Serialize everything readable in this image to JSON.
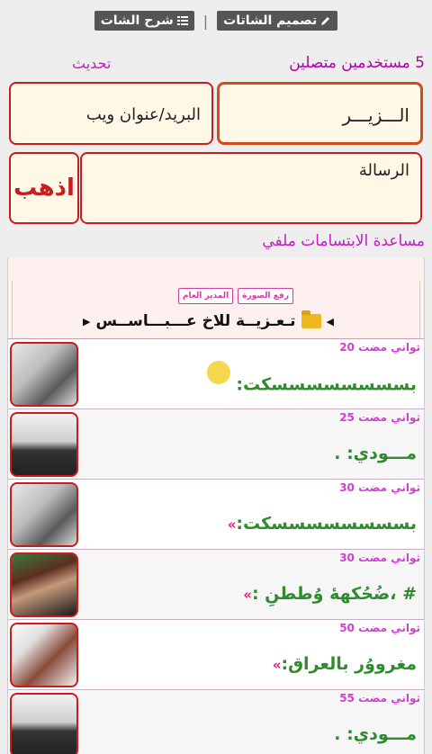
{
  "topbar": {
    "design_label": "تصميم الشاتات",
    "explain_label": "شرح الشات",
    "separator": "|"
  },
  "status": {
    "online_text": "5 مستخدمين متصلين",
    "refresh_label": "تحديث"
  },
  "form": {
    "name_value": "الـــزيـــر",
    "email_placeholder": "البريد/عنوان ويب",
    "message_placeholder": "الرسالة",
    "send_label": "اذهب"
  },
  "smiley_help": "مساعدة الابتسامات ملفي",
  "header_panel": {
    "badge_upload": "رفع الصورة",
    "badge_admin": "المدير العام",
    "topic": "تـعـزيــة للاخ عـــبـــاســس"
  },
  "messages": [
    {
      "time": "ثواني مضت 20",
      "text": "بسسسسسسسسكت:",
      "extra": "",
      "avatar": "av1",
      "emoji": true
    },
    {
      "time": "ثواني مضت 25",
      "text": "مـــودي: .",
      "extra": "",
      "avatar": "av2",
      "emoji": false
    },
    {
      "time": "ثواني مضت 30",
      "text": "بسسسسسسسسكت:",
      "extra": "»",
      "avatar": "av1",
      "emoji": false
    },
    {
      "time": "ثواني مضت 30",
      "text": "# ،ضُحُكههٔ وُططنِ :",
      "extra": "»",
      "avatar": "av3",
      "emoji": false
    },
    {
      "time": "ثواني مضت 50",
      "text": "مغرووُر بالعراق:",
      "extra": "»",
      "avatar": "av4",
      "emoji": false
    },
    {
      "time": "ثواني مضت 55",
      "text": "مـــودي: .",
      "extra": "",
      "avatar": "av2",
      "emoji": false
    }
  ]
}
